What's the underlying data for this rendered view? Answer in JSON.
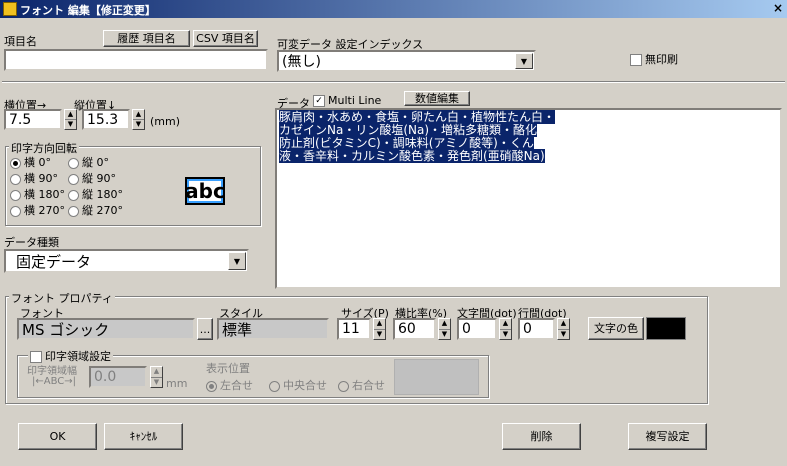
{
  "window": {
    "title": "フォント 編集【修正変更】",
    "close": "×"
  },
  "item": {
    "label": "項目名",
    "history_button": "履歴 項目名",
    "csv_button": "CSV 項目名",
    "value": ""
  },
  "variable": {
    "label": "可変データ 設定インデックス",
    "value": "(無し)"
  },
  "no_print": {
    "label": "無印刷",
    "checked": false
  },
  "position": {
    "h_label": "横位置→",
    "v_label": "縦位置↓",
    "h_value": "7.5",
    "v_value": "15.3",
    "unit": "(mm)"
  },
  "direction": {
    "title": "印字方向回転",
    "options": [
      "横 0°",
      "縦 0°",
      "横 90°",
      "縦 90°",
      "横 180°",
      "縦 180°",
      "横 270°",
      "縦 270°"
    ],
    "selected": "横 0°",
    "preview": "abc"
  },
  "datatype": {
    "label": "データ種類",
    "value": "固定データ"
  },
  "data": {
    "label": "データ",
    "multiline_label": "Multi Line",
    "multiline_checked": true,
    "edit_button": "数値編集",
    "lines": [
      "豚肩肉・水あめ・食塩・卵たん白・植物性たん白・",
      "カゼインNa・リン酸塩(Na)・増粘多糖類・酪化",
      "防止剤(ビタミンC)・調味料(アミノ酸等)・くん",
      "液・香辛料・カルミン酸色素・発色剤(亜硝酸Na)"
    ]
  },
  "font_props": {
    "title": "フォント プロパティ",
    "font_label": "フォント",
    "font_value": "MS ゴシック",
    "browse": "...",
    "style_label": "スタイル",
    "style_value": "標準",
    "size_label": "サイズ(P)",
    "size_value": "11",
    "ratio_label": "横比率(%)",
    "ratio_value": "60",
    "char_space_label": "文字間(dot)",
    "char_space_value": "0",
    "line_space_label": "行間(dot)",
    "line_space_value": "0",
    "color_button": "文字の色",
    "color": "#000000"
  },
  "print_area": {
    "title": "印字領域設定",
    "checked": false,
    "width_label_1": "印字領域幅",
    "width_label_2": "|←ABC→|",
    "width_value": "0.0",
    "unit": "mm",
    "align_label": "表示位置",
    "align_options": [
      "左合せ",
      "中央合せ",
      "右合せ"
    ],
    "align_selected": "左合せ"
  },
  "buttons": {
    "ok": "OK",
    "cancel": "ｷｬﾝｾﾙ",
    "delete": "削除",
    "copy": "複写設定"
  }
}
